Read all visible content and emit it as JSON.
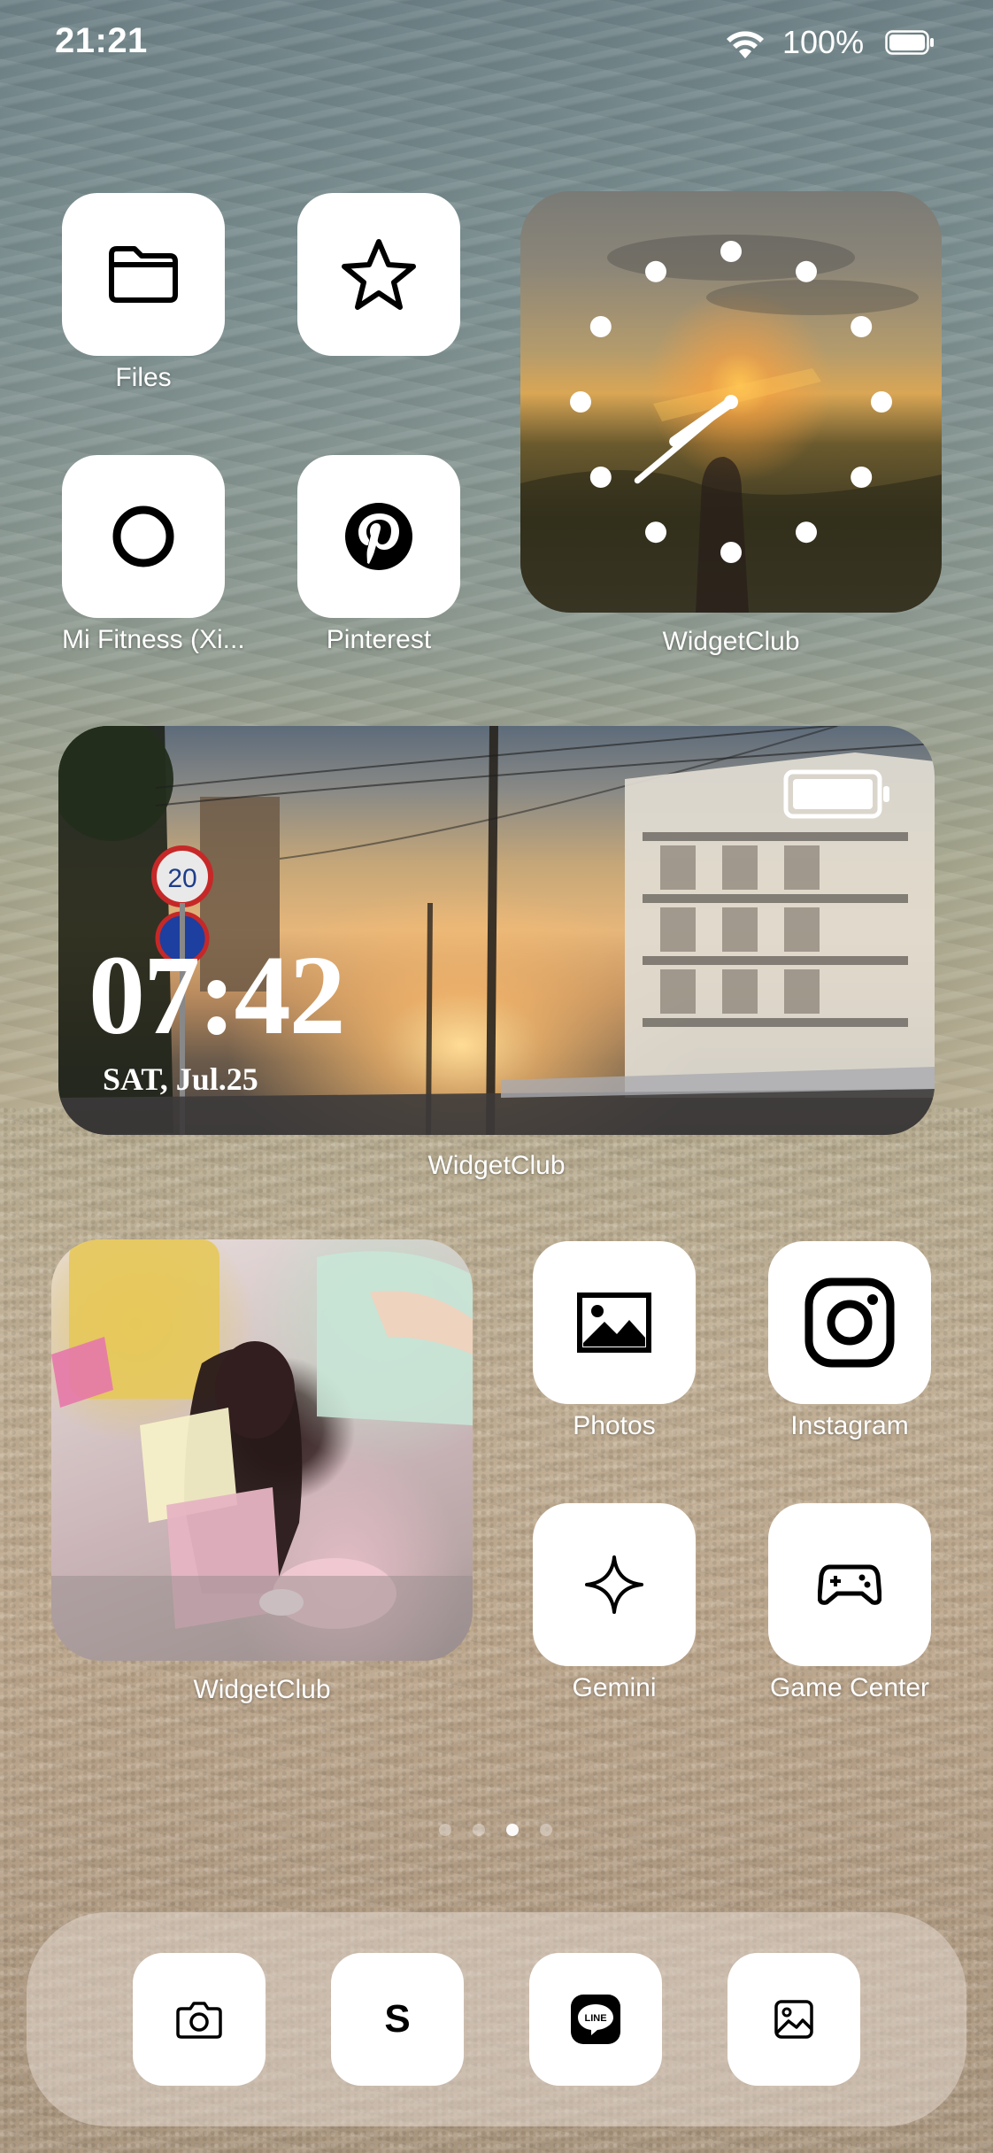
{
  "status_bar": {
    "time": "21:21",
    "battery_percent": "100%"
  },
  "home": {
    "apps": [
      {
        "id": "files",
        "label": "Files",
        "icon": "folder-icon"
      },
      {
        "id": "favorites",
        "label": "",
        "icon": "star-icon"
      },
      {
        "id": "mifitness",
        "label": "Mi Fitness (Xi...",
        "icon": "ring-icon"
      },
      {
        "id": "pinterest",
        "label": "Pinterest",
        "icon": "pinterest-icon"
      },
      {
        "id": "photos",
        "label": "Photos",
        "icon": "photo-icon"
      },
      {
        "id": "instagram",
        "label": "Instagram",
        "icon": "instagram-icon"
      },
      {
        "id": "gemini",
        "label": "Gemini",
        "icon": "sparkle-icon"
      },
      {
        "id": "gamecenter",
        "label": "Game Center",
        "icon": "gamepad-icon"
      }
    ],
    "widgets": {
      "clock": {
        "label": "WidgetClub",
        "hour_hand_deg": 235,
        "minute_hand_deg": 230
      },
      "photo_clock": {
        "label": "WidgetClub",
        "time": "07:42",
        "date": "SAT, Jul.25",
        "sign_number": "20"
      },
      "photo": {
        "label": "WidgetClub"
      }
    }
  },
  "page_indicator": {
    "count": 4,
    "active_index": 2
  },
  "dock": [
    {
      "id": "camera",
      "icon": "camera-icon"
    },
    {
      "id": "s-app",
      "letter": "S",
      "icon": "s-letter-icon"
    },
    {
      "id": "line",
      "text": "LINE",
      "icon": "line-icon"
    },
    {
      "id": "gallery",
      "icon": "image-icon"
    }
  ],
  "colors": {
    "icon_tile": "#ffffff",
    "label": "#ffffff",
    "line_brand": "#000000"
  }
}
